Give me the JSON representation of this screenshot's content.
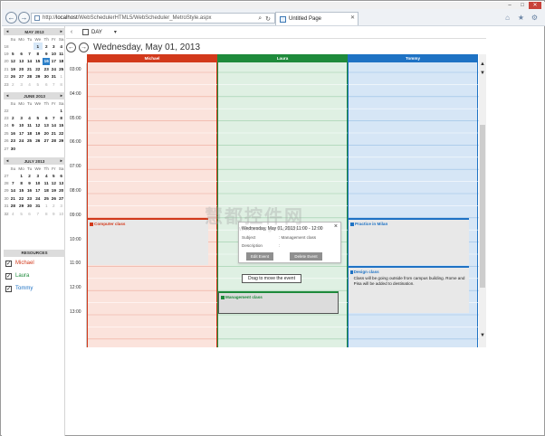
{
  "browser": {
    "url_prefix": "http://",
    "url_host": "localhost",
    "url_path": "/WebSchedulerHTML5/WebScheduler_MetroStyle.aspx",
    "tab_title": "Untitled Page",
    "search_glyph": "⌕",
    "refresh_glyph": "↻",
    "close_glyph": "✕",
    "home_glyph": "⌂",
    "star_glyph": "★",
    "gear_glyph": "⚙",
    "min_glyph": "–",
    "max_glyph": "□",
    "back_glyph": "←",
    "fwd_glyph": "→"
  },
  "scheduler": {
    "view_label": "DAY",
    "view_dropdown_glyph": "▾",
    "collapse_glyph": "‹",
    "prev_glyph": "←",
    "next_glyph": "→",
    "date_title": "Wednesday, May 01, 2013",
    "time_labels": [
      "03:00",
      "04:00",
      "05:00",
      "06:00",
      "07:00",
      "08:00",
      "09:00",
      "10:00",
      "11:00",
      "12:00",
      "13:00"
    ],
    "resources": [
      {
        "name": "Michael",
        "color": "#d2391b",
        "light": "#fbe3dc"
      },
      {
        "name": "Laura",
        "color": "#1e8a3b",
        "light": "#dff0e3"
      },
      {
        "name": "Tommy",
        "color": "#1e72c4",
        "light": "#d6e6f6"
      }
    ],
    "events": [
      {
        "title": "Computer class",
        "resource": 0,
        "color": "#d2391b",
        "desc": ""
      },
      {
        "title": "Management class",
        "resource": 1,
        "color": "#1e8a3b",
        "desc": ""
      },
      {
        "title": "Practice in Milan",
        "resource": 2,
        "color": "#1e72c4",
        "desc": ""
      },
      {
        "title": "Design class",
        "resource": 2,
        "color": "#1e72c4",
        "desc": "Class will be going outside from campus building. Rome and Pisa will be added to destination."
      }
    ]
  },
  "popup": {
    "title": "Wednesday, May 01, 2013 11:00 - 12:00",
    "close": "×",
    "subject_label": "Subject",
    "subject_value": ": Management class",
    "desc_label": "Description",
    "desc_value": ":",
    "edit_button": "Edit Event",
    "delete_button": "Delete Event",
    "drag_tip": "Drag to move the event"
  },
  "calendars": [
    {
      "title": "MAY 2013",
      "weeks": [
        [
          "18",
          "",
          "",
          "",
          "1",
          "2",
          "3",
          "4"
        ],
        [
          "19",
          "5",
          "6",
          "7",
          "8",
          "9",
          "10",
          "11"
        ],
        [
          "20",
          "12",
          "13",
          "14",
          "15",
          "16",
          "17",
          "18"
        ],
        [
          "21",
          "19",
          "20",
          "21",
          "22",
          "23",
          "24",
          "25"
        ],
        [
          "22",
          "26",
          "27",
          "28",
          "29",
          "30",
          "31",
          "1"
        ],
        [
          "23",
          "2",
          "3",
          "4",
          "5",
          "6",
          "7",
          "8"
        ]
      ],
      "dim": [
        [
          4,
          7
        ],
        [
          5,
          1
        ],
        [
          5,
          2
        ],
        [
          5,
          3
        ],
        [
          5,
          4
        ],
        [
          5,
          5
        ],
        [
          5,
          6
        ],
        [
          5,
          7
        ]
      ]
    },
    {
      "title": "JUNE 2013",
      "weeks": [
        [
          "22",
          "",
          "",
          "",
          "",
          "",
          "",
          "1"
        ],
        [
          "23",
          "2",
          "3",
          "4",
          "5",
          "6",
          "7",
          "8"
        ],
        [
          "24",
          "9",
          "10",
          "11",
          "12",
          "13",
          "14",
          "15"
        ],
        [
          "25",
          "16",
          "17",
          "18",
          "19",
          "20",
          "21",
          "22"
        ],
        [
          "26",
          "23",
          "24",
          "25",
          "26",
          "27",
          "28",
          "29"
        ],
        [
          "27",
          "30",
          "",
          "",
          "",
          "",
          "",
          ""
        ]
      ],
      "dim": []
    },
    {
      "title": "JULY 2013",
      "weeks": [
        [
          "27",
          "",
          "1",
          "2",
          "3",
          "4",
          "5",
          "6"
        ],
        [
          "28",
          "7",
          "8",
          "9",
          "10",
          "11",
          "12",
          "13"
        ],
        [
          "29",
          "14",
          "15",
          "16",
          "17",
          "18",
          "19",
          "20"
        ],
        [
          "30",
          "21",
          "22",
          "23",
          "24",
          "25",
          "26",
          "27"
        ],
        [
          "31",
          "28",
          "29",
          "30",
          "31",
          "1",
          "2",
          "3"
        ],
        [
          "32",
          "4",
          "5",
          "6",
          "7",
          "8",
          "9",
          "10"
        ]
      ],
      "dim": [
        [
          4,
          5
        ],
        [
          4,
          6
        ],
        [
          4,
          7
        ],
        [
          5,
          1
        ],
        [
          5,
          2
        ],
        [
          5,
          3
        ],
        [
          5,
          4
        ],
        [
          5,
          5
        ],
        [
          5,
          6
        ],
        [
          5,
          7
        ]
      ]
    }
  ],
  "calendar_day_names": [
    "Su",
    "Mo",
    "Tu",
    "We",
    "Th",
    "Fr",
    "Sa"
  ],
  "calendar_nav": {
    "prev": "◂",
    "next": "▸"
  },
  "resources_header": "RESOURCES",
  "check_glyph": "✓",
  "watermark": {
    "main": "慧都控件网",
    "sub": "www.evget.com"
  }
}
